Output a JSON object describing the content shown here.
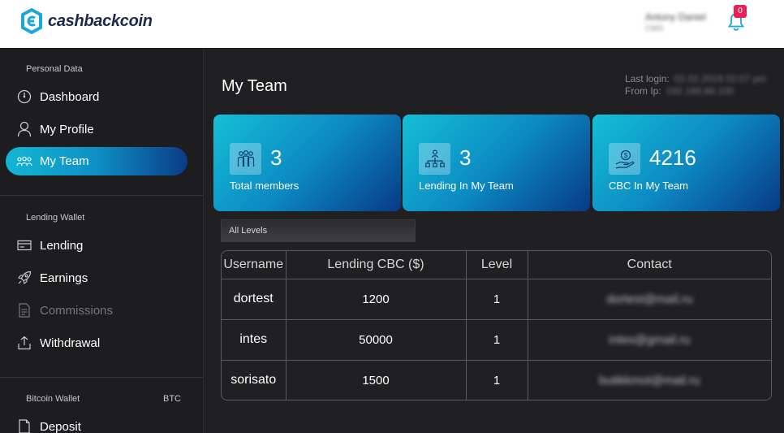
{
  "app": {
    "brand": "cashbackcoin"
  },
  "header": {
    "user_name": "Antony Daniel",
    "user_role": "CMS",
    "notification_count": "0"
  },
  "sidebar": {
    "personal_title": "Personal Data",
    "personal_items": [
      {
        "label": "Dashboard",
        "icon": "speedometer-icon"
      },
      {
        "label": "My Profile",
        "icon": "user-icon"
      },
      {
        "label": "My Team",
        "icon": "team-icon",
        "active": true
      }
    ],
    "lending_title": "Lending Wallet",
    "lending_items": [
      {
        "label": "Lending",
        "icon": "card-icon"
      },
      {
        "label": "Earnings",
        "icon": "rocket-icon"
      },
      {
        "label": "Commissions",
        "icon": "document-icon",
        "disabled": true
      },
      {
        "label": "Withdrawal",
        "icon": "upload-icon"
      }
    ],
    "bitcoin_title": "Bitcoin Wallet",
    "bitcoin_badge": "BTC",
    "bitcoin_items": [
      {
        "label": "Deposit",
        "icon": "file-icon"
      }
    ]
  },
  "main": {
    "title": "My Team",
    "last_login_label": "Last login:",
    "last_login_value": "02.02.2019 02:07 pm",
    "from_ip_label": "From Ip:",
    "from_ip_value": "192.168.88.100",
    "cards": [
      {
        "value": "3",
        "label": "Total members",
        "icon": "members-icon"
      },
      {
        "value": "3",
        "label": "Lending In My Team",
        "icon": "hierarchy-icon"
      },
      {
        "value": "4216",
        "label": "CBC In My Team",
        "icon": "coin-hand-icon"
      }
    ],
    "level_filter": "All Levels",
    "table": {
      "headers": [
        "Username",
        "Lending CBC ($)",
        "Level",
        "Contact"
      ],
      "rows": [
        [
          "dortest",
          "1200",
          "1",
          "dortest@mail.ru"
        ],
        [
          "intes",
          "50000",
          "1",
          "intes@gmail.ru"
        ],
        [
          "sorisato",
          "1500",
          "1",
          "butikkmot@mail.ru"
        ]
      ]
    }
  },
  "colors": {
    "accent_start": "#12b6d4",
    "accent_end": "#0b3c86",
    "badge": "#e8205a",
    "background": "#202023"
  }
}
